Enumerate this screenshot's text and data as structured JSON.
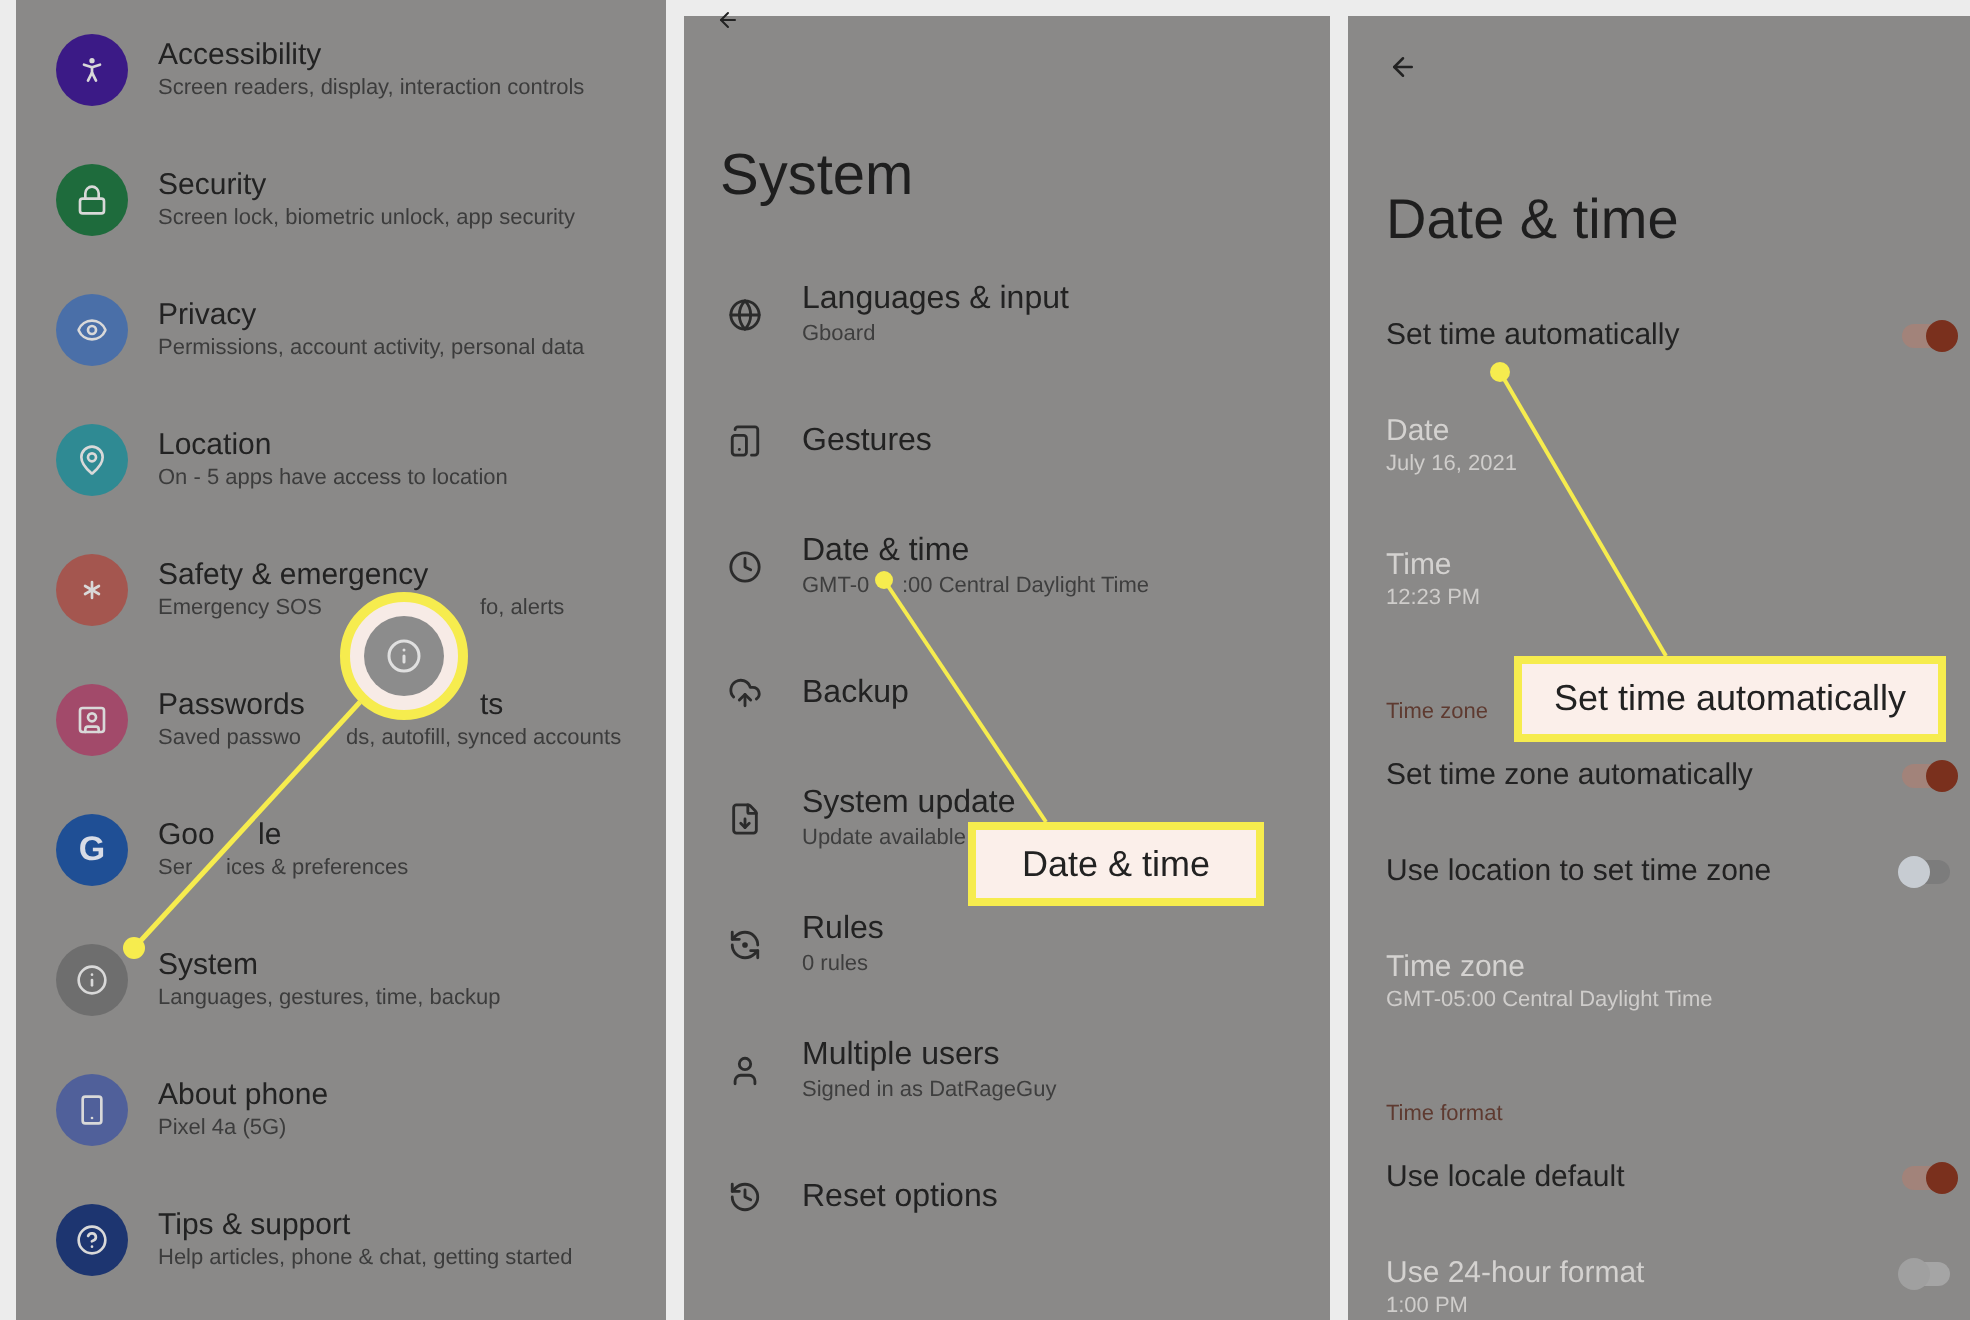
{
  "settings_panel": {
    "items": [
      {
        "color": "#3b1a86",
        "title": "Accessibility",
        "subtitle": "Screen readers, display, interaction controls"
      },
      {
        "color": "#1e6b3c",
        "title": "Security",
        "subtitle": "Screen lock, biometric unlock, app security"
      },
      {
        "color": "#4a6fa8",
        "title": "Privacy",
        "subtitle": "Permissions, account activity, personal data"
      },
      {
        "color": "#2f8a93",
        "title": "Location",
        "subtitle": "On - 5 apps have access to location"
      },
      {
        "color": "#a4564f",
        "title": "Safety & emergency",
        "subtitle": [
          "Emergency SOS",
          "fo, alerts"
        ]
      },
      {
        "color": "#a24a6a",
        "title": [
          "Passwords",
          "ts"
        ],
        "subtitle": [
          "Saved passwo",
          "ds, autofill, synced accounts"
        ]
      },
      {
        "icon_text": "G",
        "color": "#1f4f95",
        "title": [
          "Goo",
          "le"
        ],
        "subtitle": [
          "Ser",
          "ices & preferences"
        ]
      },
      {
        "color": "#6e6e6e",
        "title": "System",
        "subtitle": "Languages, gestures, time, backup"
      },
      {
        "color": "#50609a",
        "title": "About phone",
        "subtitle": "Pixel 4a (5G)"
      },
      {
        "color": "#1d3570",
        "title": "Tips & support",
        "subtitle": "Help articles, phone & chat, getting started"
      }
    ]
  },
  "system_panel": {
    "title": "System",
    "items": [
      {
        "title": "Languages & input",
        "subtitle": "Gboard"
      },
      {
        "title": "Gestures"
      },
      {
        "title": "Date & time",
        "subtitle": [
          "GMT-0",
          ":00 Central Daylight Time"
        ]
      },
      {
        "title": "Backup"
      },
      {
        "title": "System update",
        "subtitle": "Update available"
      },
      {
        "title": "Rules",
        "subtitle": "0 rules"
      },
      {
        "title": "Multiple users",
        "subtitle": "Signed in as DatRageGuy"
      },
      {
        "title": "Reset options"
      }
    ]
  },
  "date_time_panel": {
    "title": "Date & time",
    "rows": [
      {
        "kind": "toggle",
        "title": "Set time automatically",
        "on": true,
        "disabled": false
      },
      {
        "kind": "value",
        "title": "Date",
        "subtitle": "July 16, 2021",
        "disabled": true
      },
      {
        "kind": "value",
        "title": "Time",
        "subtitle": "12:23 PM",
        "disabled": true
      },
      {
        "kind": "header",
        "title": "Time zone"
      },
      {
        "kind": "toggle",
        "title": "Set time zone automatically",
        "on": true,
        "disabled": false
      },
      {
        "kind": "toggle",
        "title": "Use location to set time zone",
        "on": false,
        "disabled": false
      },
      {
        "kind": "value",
        "title": "Time zone",
        "subtitle": "GMT-05:00 Central Daylight Time",
        "disabled": true
      },
      {
        "kind": "header",
        "title": "Time format"
      },
      {
        "kind": "toggle",
        "title": "Use locale default",
        "on": true,
        "disabled": false
      },
      {
        "kind": "toggle",
        "title": "Use 24-hour format",
        "subtitle": "1:00 PM",
        "on": false,
        "disabled": true
      }
    ]
  },
  "callouts": [
    {
      "text": "Date & time"
    },
    {
      "text": "Set time automatically"
    }
  ]
}
